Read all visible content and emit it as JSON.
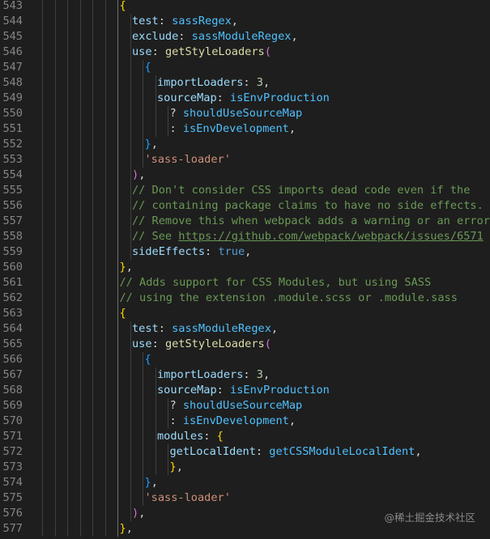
{
  "editor": {
    "lines": [
      {
        "n": "543",
        "indent": 7,
        "tokens": [
          {
            "t": "{",
            "c": "y"
          }
        ]
      },
      {
        "n": "544",
        "indent": 8,
        "tokens": [
          {
            "t": "test",
            "c": "prop"
          },
          {
            "t": ": ",
            "c": "punc"
          },
          {
            "t": "sassRegex",
            "c": "const"
          },
          {
            "t": ",",
            "c": "punc"
          }
        ]
      },
      {
        "n": "545",
        "indent": 8,
        "tokens": [
          {
            "t": "exclude",
            "c": "prop"
          },
          {
            "t": ": ",
            "c": "punc"
          },
          {
            "t": "sassModuleRegex",
            "c": "const"
          },
          {
            "t": ",",
            "c": "punc"
          }
        ]
      },
      {
        "n": "546",
        "indent": 8,
        "tokens": [
          {
            "t": "use",
            "c": "prop"
          },
          {
            "t": ": ",
            "c": "punc"
          },
          {
            "t": "getStyleLoaders",
            "c": "func"
          },
          {
            "t": "(",
            "c": "p"
          }
        ]
      },
      {
        "n": "547",
        "indent": 9,
        "tokens": [
          {
            "t": "{",
            "c": "b"
          }
        ]
      },
      {
        "n": "548",
        "indent": 10,
        "tokens": [
          {
            "t": "importLoaders",
            "c": "prop"
          },
          {
            "t": ": ",
            "c": "punc"
          },
          {
            "t": "3",
            "c": "num"
          },
          {
            "t": ",",
            "c": "punc"
          }
        ]
      },
      {
        "n": "549",
        "indent": 10,
        "tokens": [
          {
            "t": "sourceMap",
            "c": "prop"
          },
          {
            "t": ": ",
            "c": "punc"
          },
          {
            "t": "isEnvProduction",
            "c": "const"
          }
        ]
      },
      {
        "n": "550",
        "indent": 11,
        "tokens": [
          {
            "t": "? ",
            "c": "punc"
          },
          {
            "t": "shouldUseSourceMap",
            "c": "const"
          }
        ]
      },
      {
        "n": "551",
        "indent": 11,
        "tokens": [
          {
            "t": ": ",
            "c": "punc"
          },
          {
            "t": "isEnvDevelopment",
            "c": "const"
          },
          {
            "t": ",",
            "c": "punc"
          }
        ]
      },
      {
        "n": "552",
        "indent": 9,
        "tokens": [
          {
            "t": "}",
            "c": "b"
          },
          {
            "t": ",",
            "c": "punc"
          }
        ]
      },
      {
        "n": "553",
        "indent": 9,
        "tokens": [
          {
            "t": "'sass-loader'",
            "c": "str"
          }
        ]
      },
      {
        "n": "554",
        "indent": 8,
        "tokens": [
          {
            "t": ")",
            "c": "p"
          },
          {
            "t": ",",
            "c": "punc"
          }
        ]
      },
      {
        "n": "555",
        "indent": 8,
        "tokens": [
          {
            "t": "// Don't consider CSS imports dead code even if the",
            "c": "comm"
          }
        ]
      },
      {
        "n": "556",
        "indent": 8,
        "tokens": [
          {
            "t": "// containing package claims to have no side effects.",
            "c": "comm"
          }
        ]
      },
      {
        "n": "557",
        "indent": 8,
        "tokens": [
          {
            "t": "// Remove this when webpack adds a warning or an error for this.",
            "c": "comm"
          }
        ]
      },
      {
        "n": "558",
        "indent": 8,
        "tokens": [
          {
            "t": "// See ",
            "c": "comm"
          },
          {
            "t": "https://github.com/webpack/webpack/issues/6571",
            "c": "link"
          }
        ]
      },
      {
        "n": "559",
        "indent": 8,
        "tokens": [
          {
            "t": "sideEffects",
            "c": "prop"
          },
          {
            "t": ": ",
            "c": "punc"
          },
          {
            "t": "true",
            "c": "bool"
          },
          {
            "t": ",",
            "c": "punc"
          }
        ]
      },
      {
        "n": "560",
        "indent": 7,
        "tokens": [
          {
            "t": "}",
            "c": "y"
          },
          {
            "t": ",",
            "c": "punc"
          }
        ]
      },
      {
        "n": "561",
        "indent": 7,
        "tokens": [
          {
            "t": "// Adds support for CSS Modules, but using SASS",
            "c": "comm"
          }
        ]
      },
      {
        "n": "562",
        "indent": 7,
        "tokens": [
          {
            "t": "// using the extension .module.scss or .module.sass",
            "c": "comm"
          }
        ]
      },
      {
        "n": "563",
        "indent": 7,
        "tokens": [
          {
            "t": "{",
            "c": "y"
          }
        ]
      },
      {
        "n": "564",
        "indent": 8,
        "tokens": [
          {
            "t": "test",
            "c": "prop"
          },
          {
            "t": ": ",
            "c": "punc"
          },
          {
            "t": "sassModuleRegex",
            "c": "const"
          },
          {
            "t": ",",
            "c": "punc"
          }
        ]
      },
      {
        "n": "565",
        "indent": 8,
        "tokens": [
          {
            "t": "use",
            "c": "prop"
          },
          {
            "t": ": ",
            "c": "punc"
          },
          {
            "t": "getStyleLoaders",
            "c": "func"
          },
          {
            "t": "(",
            "c": "p"
          }
        ]
      },
      {
        "n": "566",
        "indent": 9,
        "tokens": [
          {
            "t": "{",
            "c": "b"
          }
        ]
      },
      {
        "n": "567",
        "indent": 10,
        "tokens": [
          {
            "t": "importLoaders",
            "c": "prop"
          },
          {
            "t": ": ",
            "c": "punc"
          },
          {
            "t": "3",
            "c": "num"
          },
          {
            "t": ",",
            "c": "punc"
          }
        ]
      },
      {
        "n": "568",
        "indent": 10,
        "tokens": [
          {
            "t": "sourceMap",
            "c": "prop"
          },
          {
            "t": ": ",
            "c": "punc"
          },
          {
            "t": "isEnvProduction",
            "c": "const"
          }
        ]
      },
      {
        "n": "569",
        "indent": 11,
        "tokens": [
          {
            "t": "? ",
            "c": "punc"
          },
          {
            "t": "shouldUseSourceMap",
            "c": "const"
          }
        ]
      },
      {
        "n": "570",
        "indent": 11,
        "tokens": [
          {
            "t": ": ",
            "c": "punc"
          },
          {
            "t": "isEnvDevelopment",
            "c": "const"
          },
          {
            "t": ",",
            "c": "punc"
          }
        ]
      },
      {
        "n": "571",
        "indent": 10,
        "tokens": [
          {
            "t": "modules",
            "c": "prop"
          },
          {
            "t": ": ",
            "c": "punc"
          },
          {
            "t": "{",
            "c": "y"
          }
        ]
      },
      {
        "n": "572",
        "indent": 11,
        "tokens": [
          {
            "t": "getLocalIdent",
            "c": "prop"
          },
          {
            "t": ": ",
            "c": "punc"
          },
          {
            "t": "getCSSModuleLocalIdent",
            "c": "const"
          },
          {
            "t": ",",
            "c": "punc"
          }
        ]
      },
      {
        "n": "573",
        "indent": 11,
        "tokens": [
          {
            "t": "}",
            "c": "y"
          },
          {
            "t": ",",
            "c": "punc"
          }
        ]
      },
      {
        "n": "574",
        "indent": 9,
        "tokens": [
          {
            "t": "}",
            "c": "b"
          },
          {
            "t": ",",
            "c": "punc"
          }
        ]
      },
      {
        "n": "575",
        "indent": 9,
        "tokens": [
          {
            "t": "'sass-loader'",
            "c": "str"
          }
        ]
      },
      {
        "n": "576",
        "indent": 8,
        "tokens": [
          {
            "t": ")",
            "c": "p"
          },
          {
            "t": ",",
            "c": "punc"
          }
        ]
      },
      {
        "n": "577",
        "indent": 7,
        "tokens": [
          {
            "t": "}",
            "c": "y"
          },
          {
            "t": ",",
            "c": "punc"
          }
        ]
      }
    ]
  },
  "watermark": {
    "text": "@稀土掘金技术社区"
  },
  "colors": {
    "background": "#1e1e1e",
    "line_number": "#858585",
    "property": "#9cdcfe",
    "constant": "#4fc1ff",
    "function": "#dcdcaa",
    "number": "#b5cea8",
    "keyword": "#569cd6",
    "string": "#ce9178",
    "comment": "#6a9955"
  }
}
